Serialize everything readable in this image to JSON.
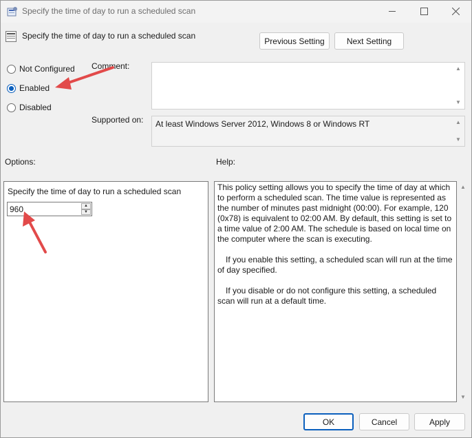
{
  "window": {
    "title": "Specify the time of day to run a scheduled scan"
  },
  "header": {
    "title": "Specify the time of day to run a scheduled scan",
    "prev_label": "Previous Setting",
    "next_label": "Next Setting"
  },
  "state": {
    "options": [
      {
        "label": "Not Configured",
        "checked": false
      },
      {
        "label": "Enabled",
        "checked": true
      },
      {
        "label": "Disabled",
        "checked": false
      }
    ]
  },
  "comment": {
    "label": "Comment:",
    "value": ""
  },
  "supported": {
    "label": "Supported on:",
    "value": "At least Windows Server 2012, Windows 8 or Windows RT"
  },
  "options_section": {
    "label": "Options:",
    "field_label": "Specify the time of day to run a scheduled scan",
    "field_value": "960"
  },
  "help_section": {
    "label": "Help:",
    "paragraphs": [
      "This policy setting allows you to specify the time of day at which to perform a scheduled scan. The time value is represented as the number of minutes past midnight (00:00).  For example, 120 (0x78) is equivalent to 02:00 AM. By default, this setting is set to a time value of 2:00 AM. The schedule is based on local time on the computer where the scan is executing.",
      "If you enable this setting, a scheduled scan will run at the time of day specified.",
      "If you disable or do not configure this setting, a scheduled scan will run at a default time."
    ]
  },
  "footer": {
    "ok_label": "OK",
    "cancel_label": "Cancel",
    "apply_label": "Apply"
  },
  "colors": {
    "accent": "#0a5fbd",
    "annotation_arrow": "#e24a4a"
  }
}
